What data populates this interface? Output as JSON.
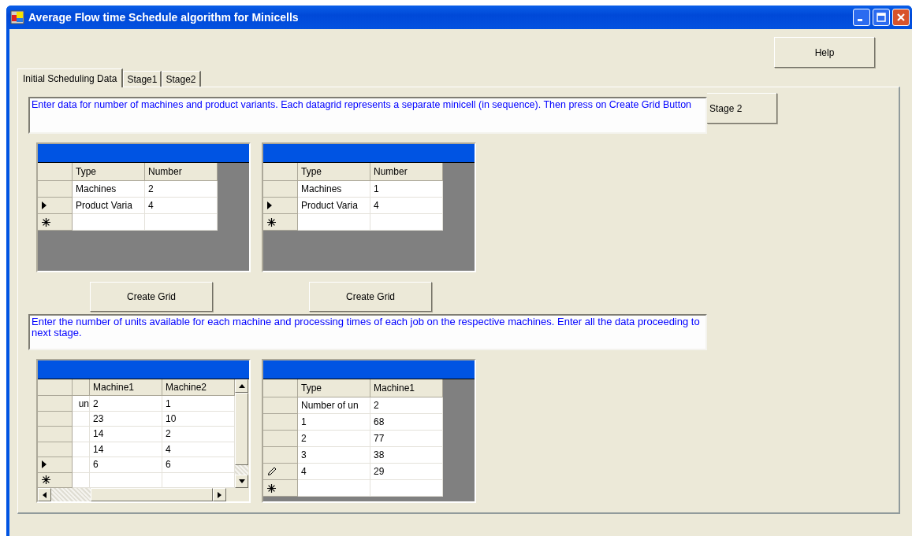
{
  "window": {
    "title": "Average Flow time Schedule algorithm for Minicells"
  },
  "help_button": "Help",
  "tabs": [
    {
      "label": "Initial Scheduling Data",
      "selected": true
    },
    {
      "label": "Stage1",
      "selected": false
    },
    {
      "label": "Stage2",
      "selected": false
    }
  ],
  "panel": {
    "instructions_1": "Enter data for number of machines and product variants. Each datagrid represents a separate minicell (in sequence). Then press on Create Grid Button",
    "stage2_button": "Stage 2",
    "input_grids": [
      {
        "columns": [
          "Type",
          "Number"
        ],
        "rows": [
          {
            "kind": "plain",
            "cells": [
              "Machines",
              "2"
            ]
          },
          {
            "kind": "current",
            "cells": [
              "Product Varia",
              "4"
            ]
          },
          {
            "kind": "new"
          }
        ]
      },
      {
        "columns": [
          "Type",
          "Number"
        ],
        "rows": [
          {
            "kind": "plain",
            "cells": [
              "Machines",
              "1"
            ]
          },
          {
            "kind": "current",
            "cells": [
              "Product Varia",
              "4"
            ]
          },
          {
            "kind": "new"
          }
        ]
      }
    ],
    "create_buttons": [
      "Create Grid",
      "Create Grid"
    ],
    "instructions_2": "Enter the number of units available for each machine and processing times of each job on the respective machines. Enter all the data proceeding to next stage.",
    "data_grids": [
      {
        "scrolled": true,
        "columns": [
          "Machine1",
          "Machine2"
        ],
        "rows": [
          {
            "kind": "plain",
            "cut_cell": "un",
            "cells": [
              "2",
              "1"
            ]
          },
          {
            "kind": "plain",
            "cells": [
              "23",
              "10"
            ]
          },
          {
            "kind": "plain",
            "cells": [
              "14",
              "2"
            ]
          },
          {
            "kind": "plain",
            "cells": [
              "14",
              "4"
            ]
          },
          {
            "kind": "current",
            "cells": [
              "6",
              "6"
            ]
          },
          {
            "kind": "new"
          }
        ]
      },
      {
        "scrolled": false,
        "columns": [
          "Type",
          "Machine1"
        ],
        "rows": [
          {
            "kind": "plain",
            "cells": [
              "Number of un",
              "2"
            ]
          },
          {
            "kind": "plain",
            "cells": [
              "1",
              "68"
            ]
          },
          {
            "kind": "plain",
            "cells": [
              "2",
              "77"
            ]
          },
          {
            "kind": "plain",
            "cells": [
              "3",
              "38"
            ]
          },
          {
            "kind": "editing",
            "cells": [
              "4",
              "29"
            ]
          },
          {
            "kind": "new"
          }
        ]
      }
    ]
  }
}
